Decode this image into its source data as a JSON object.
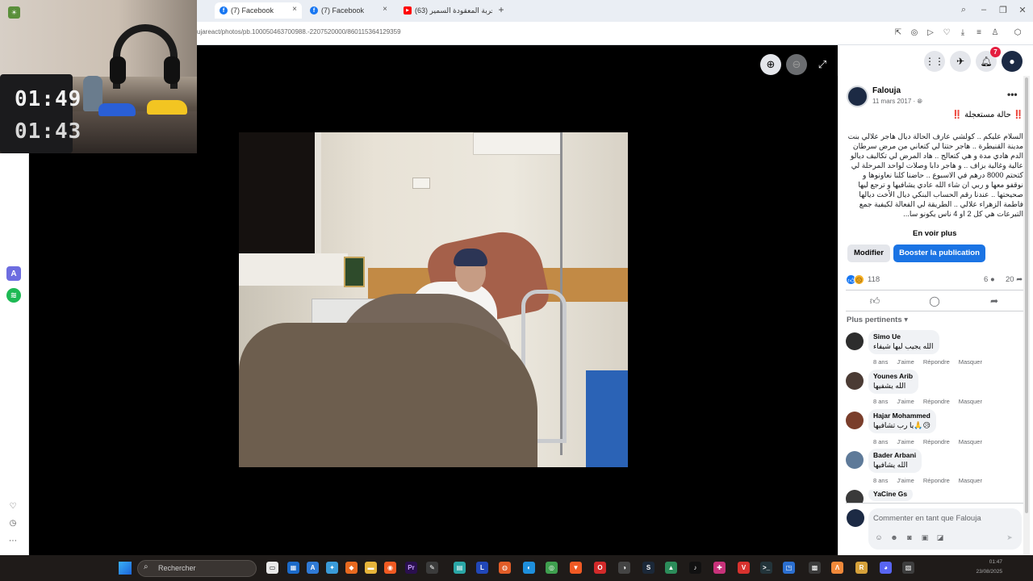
{
  "browser": {
    "tabs": [
      {
        "label": "(7) Facebook",
        "icon": "facebook-icon",
        "active": true
      },
      {
        "label": "(7) Facebook",
        "icon": "facebook-icon",
        "active": false
      },
      {
        "label": "(63) تجربة المعقودة السمير",
        "icon": "youtube-icon",
        "active": false
      }
    ],
    "new_tab_label": "+",
    "url": "ujareact/photos/pb.100050463700988.-2207520000/860115364129359",
    "accent": "#1877f2"
  },
  "webcam": {
    "clock_top": "01:49",
    "clock_bottom": "01:43"
  },
  "viewer": {
    "zoom_in_icon": "zoom-in-icon",
    "zoom_out_icon": "zoom-out-icon",
    "fullscreen_icon": "fullscreen-icon"
  },
  "header": {
    "notifications_badge": "7"
  },
  "post": {
    "author": "Falouja",
    "date": "11 mars 2017 ·",
    "title": "‼️ حالة مستعجلة ‼️",
    "text": "السلام عليكم .. كولشي عارف الحالة ديال هاجر علالي بنت مدينة القنيطرة .. هاجر حتنا لي كتعاني من مرض سرطان الدم هادي مدة و هي كتعالج .. هاد المرض لي تكاليف ديالو عالية وغالية بزاف .. و هاجر دابا وصلات لواحد المرحلة لي كتحتم 8000 درهم في الاسبوع .. حاضنا كلنا نعاونوها و نوقفو معها و ربي ان شاء الله عادي يشافيها و ترجع ليها صحيحتها .. عندنا رقم الحساب البنكي ديال الأخت ديالها فاطمة الزهراء علالي .. الطريقة لي الفعالة لكيفية جمع التبرعات هي كل 2 او 4 ناس يكونو سا...",
    "see_more": "En voir plus",
    "edit_label": "Modifier",
    "boost_label": "Booster la publication",
    "reactions_count": "118",
    "comments_count": "6",
    "shares_count": "20",
    "sort_label": "Plus pertinents"
  },
  "comments": [
    {
      "name": "Simo Ue",
      "text": "الله يجيب ليها شيفاء",
      "time": "8 ans",
      "avatar_color": "#2d2d2d"
    },
    {
      "name": "Younes Arib",
      "text": "الله يشفيها",
      "time": "8 ans",
      "avatar_color": "#4b3b34"
    },
    {
      "name": "Hajar Mohammed",
      "text": "يا رب تشافيها🙏😥",
      "time": "8 ans",
      "avatar_color": "#7a3e2b"
    },
    {
      "name": "Bader Arbani",
      "text": "الله يشافيها",
      "time": "8 ans",
      "avatar_color": "#5e7a99"
    },
    {
      "name": "YaCine Gs",
      "text": "",
      "time": "",
      "avatar_color": "#3a3a3a"
    }
  ],
  "comment_actions": {
    "like": "J'aime",
    "reply": "Répondre",
    "hide": "Masquer"
  },
  "composer": {
    "placeholder": "Commenter en tant que Falouja"
  },
  "taskbar": {
    "search_label": "Rechercher",
    "clock_time": "01:47",
    "clock_date": "23/08/2025"
  }
}
